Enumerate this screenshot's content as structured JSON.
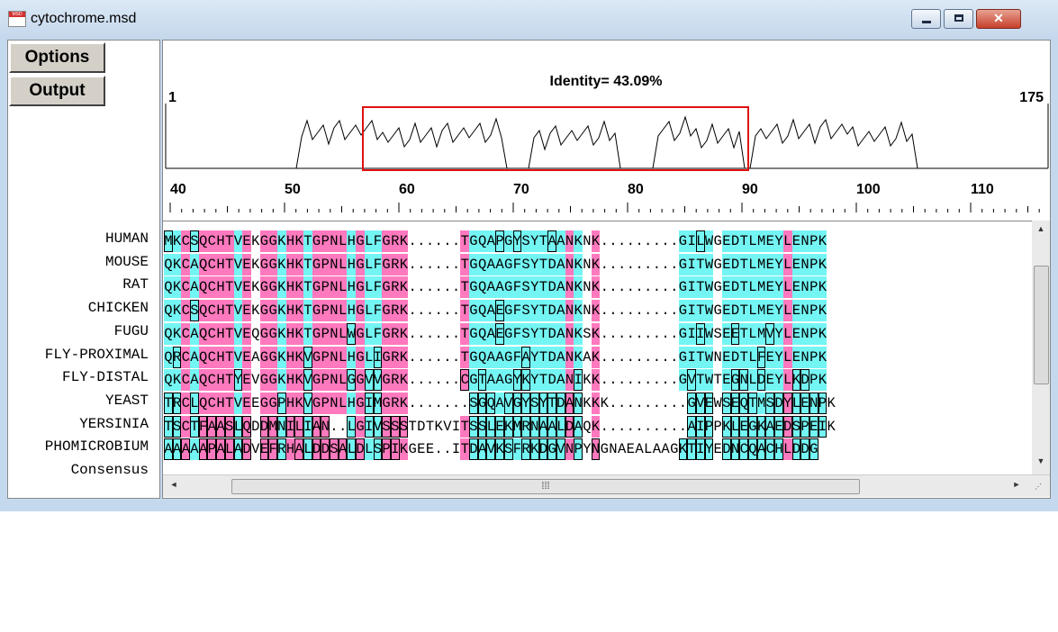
{
  "window": {
    "title": "cytochrome.msd",
    "icon_label": "MSD"
  },
  "toolbar": {
    "options_label": "Options",
    "output_label": "Output"
  },
  "identity": {
    "label": "Identity= 43.09%"
  },
  "graph": {
    "start_label": "1",
    "end_label": "175"
  },
  "ruler": {
    "labels": [
      "40",
      "50",
      "60",
      "70",
      "80",
      "90",
      "100",
      "110"
    ]
  },
  "sequences": [
    {
      "name": "HUMAN",
      "seq": "MKCSQCHTVEKGGKHKTGPNLHGLFGRK......TGQAPGYSYTAANKNK.........GILWGEDTLMEYLENPK"
    },
    {
      "name": "MOUSE",
      "seq": "QKCAQCHTVEKGGKHKTGPNLHGLFGRK......TGQAAGFSYTDANKNK.........GITWGEDTLMEYLENPK"
    },
    {
      "name": "RAT",
      "seq": "QKCAQCHTVEKGGKHKTGPNLHGLFGRK......TGQAAGFSYTDANKNK.........GITWGEDTLMEYLENPK"
    },
    {
      "name": "CHICKEN",
      "seq": "QKCSQCHTVEKGGKHKTGPNLHGLFGRK......TGQAEGFSYTDANKNK.........GITWGEDTLMEYLENPK"
    },
    {
      "name": "FUGU",
      "seq": "QKCAQCHTVEQGGKHKTGPNLWGLFGRK......TGQAEGFSYTDANKSK.........GIIWSEETLMVYLENPK"
    },
    {
      "name": "FLY-PROXIMAL",
      "seq": "QRCAQCHTVEAGGKHKVGPNLHGLIGRK......TGQAAGFAYTDANKAK.........GITWNEDTLFEYLENPK"
    },
    {
      "name": "FLY-DISTAL",
      "seq": "QKCAQCHTYEVGGKHKVGPNLGGVVGRK......CGTAAGYKYTDANIKK.........GVTWTEGNLDEYLKDPK"
    },
    {
      "name": "YEAST",
      "seq": "TRCLQCHTVEEGGPHKVGPNLHGIMGRK.......SGQAVGYSYTDANKKK.........GVEWSEQTMSDYLENPK"
    },
    {
      "name": "YERSINIA",
      "seq": "TSCTFAASLQDDMNILIAN..LGIVSSSTDTKVITSSLEKMRNAALDAQK..........AIPPKLEGKAEDSPEIK"
    },
    {
      "name": "PHOMICROBIUM",
      "seq": "AAAAAPALADVEFRHALDDSALDLSPIKGEE..ITDAVKSFRKDGVNPYNGNAEALAAGKTIYEDNCQACHLDDG"
    },
    {
      "name": "Consensus",
      "seq": ""
    }
  ],
  "colors": {
    "pink": "#ff79be",
    "cyan": "#73f5f3",
    "selection": "#e01010"
  },
  "icons": [
    "app-icon",
    "minimize-icon",
    "maximize-icon",
    "close-icon",
    "scroll-up-icon",
    "scroll-down-icon",
    "scroll-left-icon",
    "scroll-right-icon",
    "grip-icon"
  ]
}
